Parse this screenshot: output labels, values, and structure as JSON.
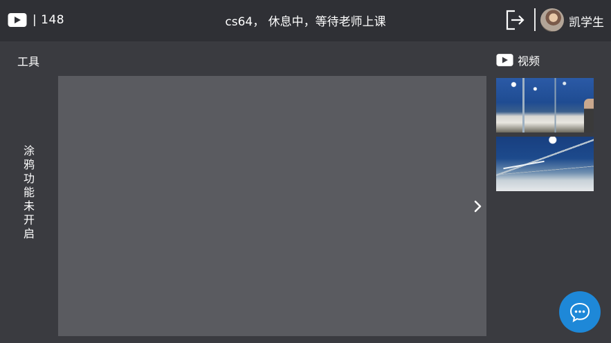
{
  "topbar": {
    "room_count": "| 148",
    "title": "cs64， 休息中，等待老师上课",
    "username": "凯学生"
  },
  "tools": {
    "label": "工具",
    "status": "涂鸦功能未开启"
  },
  "video": {
    "label": "视频"
  },
  "icons": {
    "camera": "camera-icon",
    "exit": "exit-icon",
    "chevron": "chevron-right-icon",
    "chat": "chat-bubble-icon"
  },
  "colors": {
    "background": "#3a3b40",
    "topbar": "#2f3035",
    "whiteboard": "#5a5b60",
    "chat_button": "#1e88d8"
  }
}
